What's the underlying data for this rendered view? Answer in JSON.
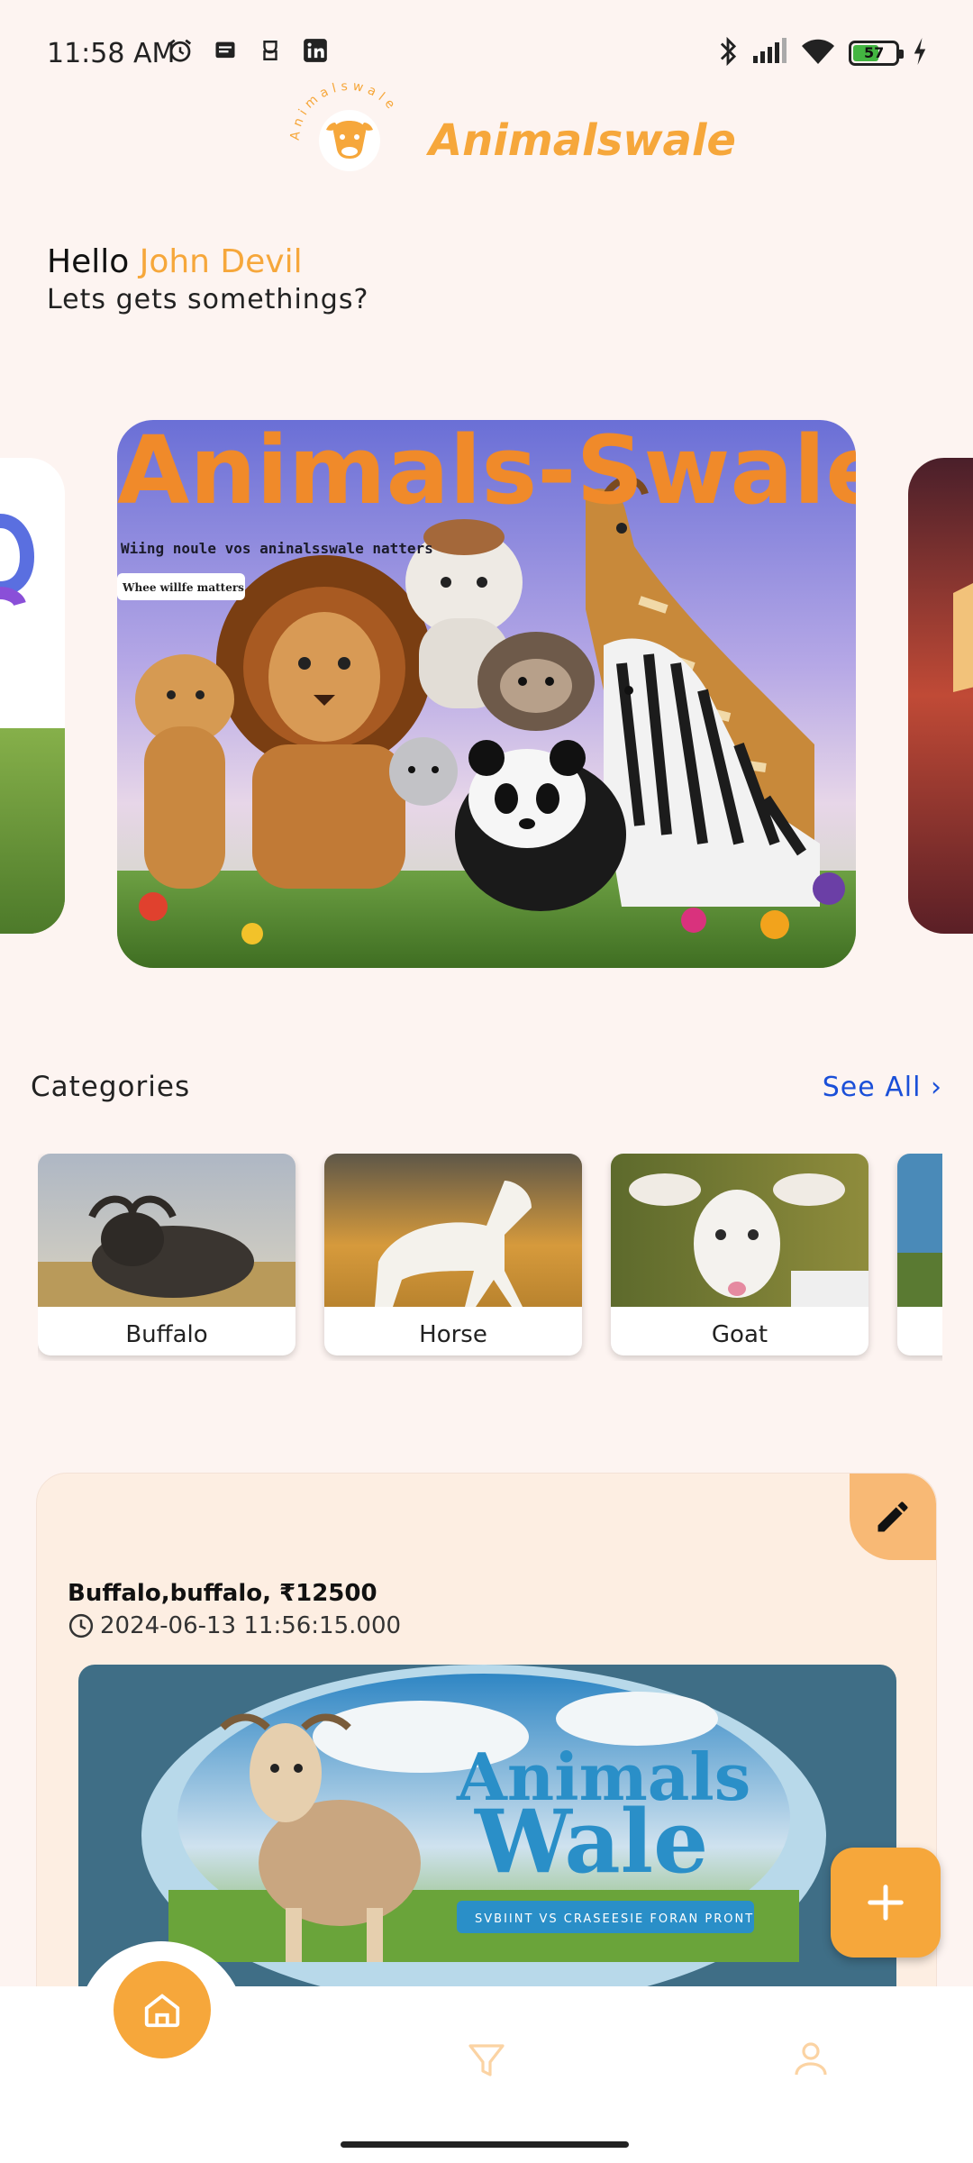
{
  "status_bar": {
    "time": "11:58 AM",
    "battery_level": "57",
    "left_icons": [
      "alarm-icon",
      "message-icon",
      "notification-icon",
      "linkedin-icon"
    ],
    "right_icons": [
      "bluetooth-icon",
      "signal-icon",
      "wifi-icon",
      "battery-icon",
      "charging-icon"
    ]
  },
  "logo": {
    "text": "Animalswale",
    "ring_text": "Animalswale",
    "brand_color": "#f6a73b"
  },
  "greeting": {
    "hello": "Hello",
    "name": "John Devil",
    "subtitle": "Lets gets somethings?"
  },
  "carousel": {
    "main_slide": {
      "headline": "Animals-Swale.",
      "tagline": "Wiing noule vos aninalsswale natters",
      "chip": "Whee willfe matters"
    }
  },
  "categories": {
    "title": "Categories",
    "see_all": "See All",
    "items": [
      {
        "label": "Buffalo"
      },
      {
        "label": "Horse"
      },
      {
        "label": "Goat"
      },
      {
        "label": ""
      }
    ]
  },
  "listing": {
    "title": "Buffalo,buffalo, ₹12500",
    "date": "2024-06-13 11:56:15.000",
    "banner": {
      "line1": "Animals",
      "line2": "Wale",
      "ribbon": "SVBIINT VS CRASEESIE FORAN PRONT"
    }
  },
  "bottom_nav": {
    "items": [
      "home-icon",
      "filter-icon",
      "profile-icon"
    ]
  },
  "colors": {
    "accent": "#f6a73b",
    "link": "#1a4fd8",
    "background": "#fdf4f1"
  }
}
